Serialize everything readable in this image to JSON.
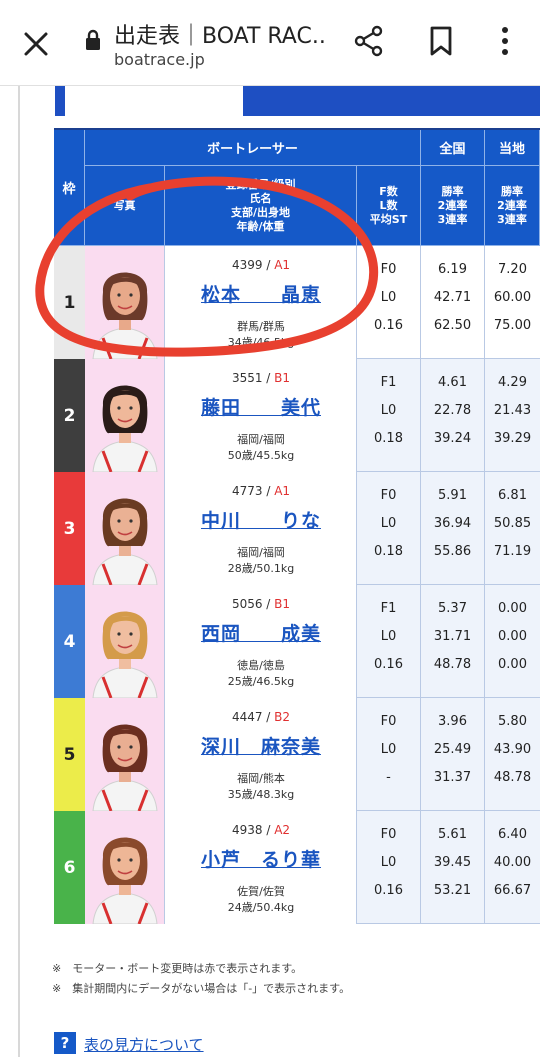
{
  "browser": {
    "title": "出走表｜BOAT RAC...",
    "url": "boatrace.jp"
  },
  "table": {
    "header": {
      "frame": "枠",
      "racer": "ボートレーサー",
      "photo": "写真",
      "info_line1": "登録番号/級別",
      "info_line2": "氏名",
      "info_line3": "支部/出身地",
      "info_line4": "年齢/体重",
      "fl_line1": "F数",
      "fl_line2": "L数",
      "fl_line3": "平均ST",
      "national": "全国",
      "local": "当地",
      "rate_line1": "勝率",
      "rate_line2": "2連率",
      "rate_line3": "3連率"
    },
    "rows": [
      {
        "frame": "1",
        "frame_color": "#e9e9e9",
        "frame_text": "#222222",
        "reg": "4399 / ",
        "cls": "A1",
        "name": "松本　　晶恵",
        "pref": "群馬/群馬",
        "age": "34歳/46.5kg",
        "f": "F0",
        "l": "L0",
        "st": "0.16",
        "n_win": "6.19",
        "n_2": "42.71",
        "n_3": "62.50",
        "l_win": "7.20",
        "l_2": "60.00",
        "l_3": "75.00"
      },
      {
        "frame": "2",
        "frame_color": "#3e3e3e",
        "frame_text": "#ffffff",
        "reg": "3551 / ",
        "cls": "B1",
        "name": "藤田　　美代",
        "pref": "福岡/福岡",
        "age": "50歳/45.5kg",
        "f": "F1",
        "l": "L0",
        "st": "0.18",
        "n_win": "4.61",
        "n_2": "22.78",
        "n_3": "39.24",
        "l_win": "4.29",
        "l_2": "21.43",
        "l_3": "39.29"
      },
      {
        "frame": "3",
        "frame_color": "#e83a3a",
        "frame_text": "#ffffff",
        "reg": "4773 / ",
        "cls": "A1",
        "name": "中川　　りな",
        "pref": "福岡/福岡",
        "age": "28歳/50.1kg",
        "f": "F0",
        "l": "L0",
        "st": "0.18",
        "n_win": "5.91",
        "n_2": "36.94",
        "n_3": "55.86",
        "l_win": "6.81",
        "l_2": "50.85",
        "l_3": "71.19"
      },
      {
        "frame": "4",
        "frame_color": "#3d7bd4",
        "frame_text": "#ffffff",
        "reg": "5056 / ",
        "cls": "B1",
        "name": "西岡　　成美",
        "pref": "徳島/徳島",
        "age": "25歳/46.5kg",
        "f": "F1",
        "l": "L0",
        "st": "0.16",
        "n_win": "5.37",
        "n_2": "31.71",
        "n_3": "48.78",
        "l_win": "0.00",
        "l_2": "0.00",
        "l_3": "0.00"
      },
      {
        "frame": "5",
        "frame_color": "#ecec4a",
        "frame_text": "#222222",
        "reg": "4447 / ",
        "cls": "B2",
        "name": "深川　麻奈美",
        "pref": "福岡/熊本",
        "age": "35歳/48.3kg",
        "f": "F0",
        "l": "L0",
        "st": "-",
        "n_win": "3.96",
        "n_2": "25.49",
        "n_3": "31.37",
        "l_win": "5.80",
        "l_2": "43.90",
        "l_3": "48.78"
      },
      {
        "frame": "6",
        "frame_color": "#49b34a",
        "frame_text": "#ffffff",
        "reg": "4938 / ",
        "cls": "A2",
        "name": "小芦　るり華",
        "pref": "佐賀/佐賀",
        "age": "24歳/50.4kg",
        "f": "F0",
        "l": "L0",
        "st": "0.16",
        "n_win": "5.61",
        "n_2": "39.45",
        "n_3": "53.21",
        "l_win": "6.40",
        "l_2": "40.00",
        "l_3": "66.67"
      }
    ]
  },
  "notes": {
    "note1": "※　モーター・ボート変更時は赤で表示されます。",
    "note2": "※　集計期間内にデータがない場合は「-」で表示されます。"
  },
  "help": {
    "icon": "?",
    "link": "表の見方について"
  },
  "colors": {
    "header_blue": "#1559c8",
    "link_blue": "#1a55c0",
    "class_red": "#e03030",
    "annotation_red": "#e8402f"
  }
}
